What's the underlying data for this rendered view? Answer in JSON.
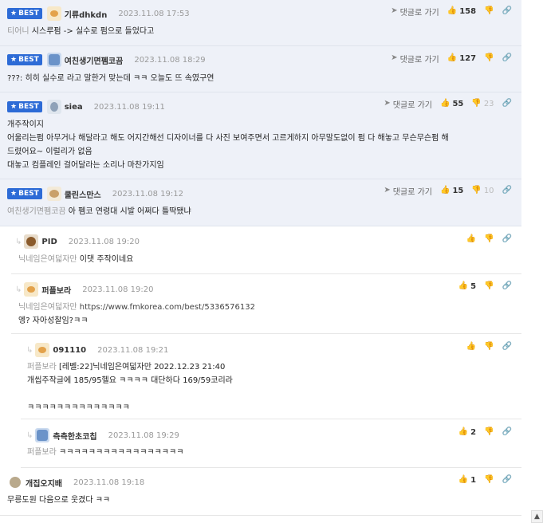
{
  "labels": {
    "best": "BEST",
    "reply": "댓글로 가기"
  },
  "icons": {
    "star": "★",
    "thumb_up": "👍",
    "thumb_down": "👎",
    "link": "🔗",
    "reply_arrow": "↳",
    "send": "➤",
    "scroll_up": "▲"
  },
  "comments": [
    {
      "nick": "기류dhkdn",
      "date": "2023.11.08 17:53",
      "up": "158",
      "down": "",
      "mention": "티어니",
      "text": "시스루펌 -> 실수로 펌으로 들었다고"
    },
    {
      "nick": "여친생기면펨코끔",
      "date": "2023.11.08 18:29",
      "up": "127",
      "down": "",
      "mention": "",
      "text": "???: 히히 실수로 라고 말한거 맞는데 ㅋㅋ 오늘도 뜨 속였구연"
    },
    {
      "nick": "siea",
      "date": "2023.11.08 19:11",
      "up": "55",
      "down": "23",
      "mention": "",
      "lines": [
        "개주작이지",
        "어울리는펌 아무거나 해달라고 해도 어지간해선 디자이너를 다 사진 보여주면서 고르게하지 아무말도없이 펌 다 해놓고 무슨무슨펌 해",
        "드렸어요~ 이럴리가 없음",
        "대놓고 컴플레인 걸어달라는 소리나 마찬가지임"
      ]
    },
    {
      "nick": "쿨린스만스",
      "date": "2023.11.08 19:12",
      "up": "15",
      "down": "10",
      "mention": "여친생기면펨코끔",
      "text": "아 펨코 연령대 시발 어쩌다 틀딱됐냐"
    },
    {
      "nick": "PID",
      "date": "2023.11.08 19:20",
      "up": "",
      "down": "",
      "mention": "닉네임은여덟자만",
      "text": "이댓 주작이네요"
    },
    {
      "nick": "퍼플보라",
      "date": "2023.11.08 19:20",
      "up": "5",
      "down": "",
      "mention": "닉네임은여덟자만",
      "url": "https://www.fmkorea.com/best/5336576132",
      "text": "엥? 자아성찰임?ㅋㅋ"
    },
    {
      "nick": "091110",
      "date": "2023.11.08 19:21",
      "up": "",
      "down": "",
      "mention": "퍼플보라",
      "line1": "[레벨:22]닉네임은여덟자만 2022.12.23 21:40",
      "line2": "개씹주작글에 185/95헬요 ㅋㅋㅋㅋ 대단하다 169/59코리라",
      "line3": "ㅋㅋㅋㅋㅋㅋㅋㅋㅋㅋㅋㅋㅋㅋ"
    },
    {
      "nick": "측측한초코칩",
      "date": "2023.11.08 19:29",
      "up": "2",
      "down": "",
      "mention": "퍼플보라",
      "text": "ㅋㅋㅋㅋㅋㅋㅋㅋㅋㅋㅋㅋㅋㅋㅋㅋㅋ"
    },
    {
      "nick": "개집오지배",
      "date": "2023.11.08 19:18",
      "up": "1",
      "down": "",
      "mention": "",
      "text": "무릉도원 다음으로 웃겼다 ㅋㅋ"
    }
  ]
}
